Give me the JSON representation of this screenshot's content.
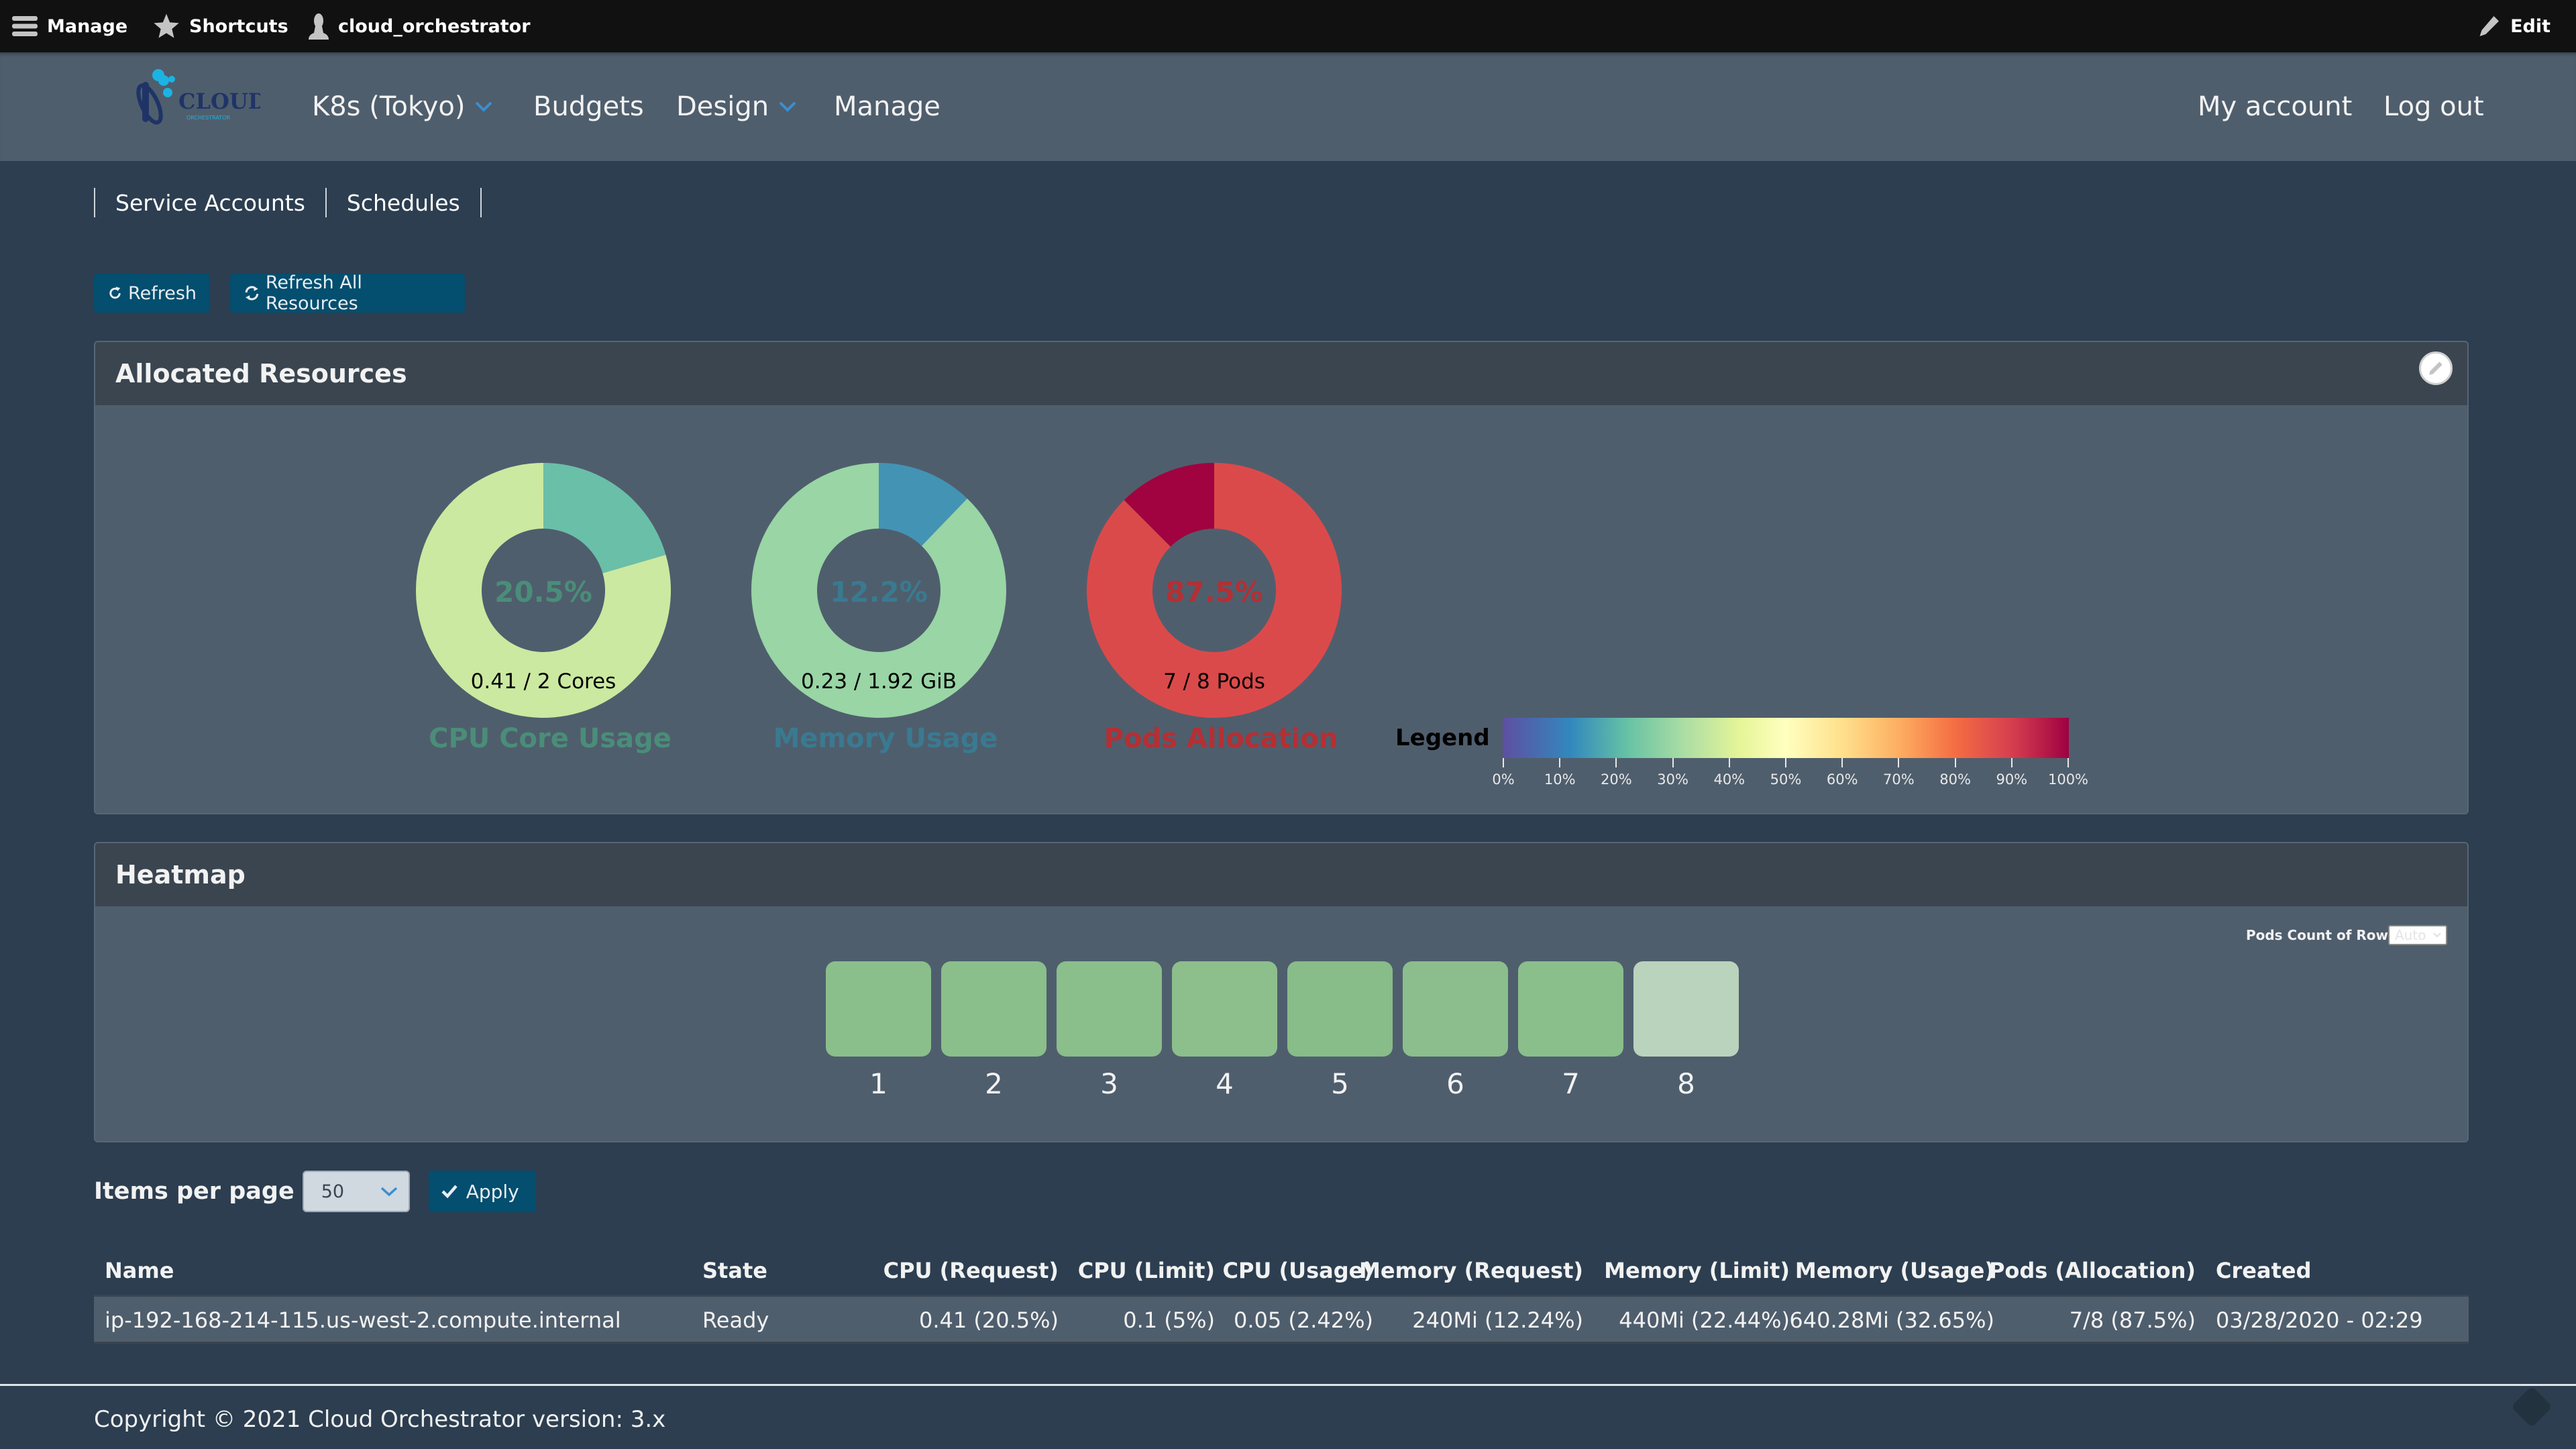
{
  "toolbar": {
    "manage_label": "Manage",
    "shortcuts_label": "Shortcuts",
    "user_label": "cloud_orchestrator",
    "edit_label": "Edit"
  },
  "navbar": {
    "logo_text": "CLOUD",
    "logo_subtext": "ORCHESTRATOR",
    "items": [
      {
        "label": "K8s (Tokyo)",
        "has_dropdown": true
      },
      {
        "label": "Budgets",
        "has_dropdown": false
      },
      {
        "label": "Design",
        "has_dropdown": true
      },
      {
        "label": "Manage",
        "has_dropdown": false
      }
    ],
    "account_label": "My account",
    "logout_label": "Log out"
  },
  "subnav": {
    "links": [
      "Service Accounts",
      "Schedules"
    ]
  },
  "actions": {
    "refresh_label": "Refresh",
    "refresh_all_label": "Refresh All Resources"
  },
  "allocated": {
    "title": "Allocated Resources",
    "donuts": [
      {
        "title": "CPU Core Usage",
        "percent_label": "20.5%",
        "percent": 20.5,
        "detail": "0.41 / 2 Cores",
        "used_color": "#6abfa9",
        "rest_color": "#cbe9a0",
        "text_color": "#4a8d79"
      },
      {
        "title": "Memory Usage",
        "percent_label": "12.2%",
        "percent": 12.2,
        "detail": "0.23 / 1.92 GiB",
        "used_color": "#4393b4",
        "rest_color": "#99d5a5",
        "text_color": "#3a7a90"
      },
      {
        "title": "Pods Allocation",
        "percent_label": "87.5%",
        "percent": 87.5,
        "detail": "7 / 8 Pods",
        "used_color": "#db4a4b",
        "rest_color": "#a0033f",
        "text_color": "#b52f33"
      }
    ],
    "legend": {
      "label": "Legend",
      "ticks": [
        "0%",
        "10%",
        "20%",
        "30%",
        "40%",
        "50%",
        "60%",
        "70%",
        "80%",
        "90%",
        "100%"
      ]
    }
  },
  "heatmap": {
    "title": "Heatmap",
    "pods_count_label": "Pods Count of Row",
    "pods_count_value": "Auto",
    "cells": [
      {
        "label": "1",
        "color": "#8abe8b"
      },
      {
        "label": "2",
        "color": "#8abe8b"
      },
      {
        "label": "3",
        "color": "#8abe8b"
      },
      {
        "label": "4",
        "color": "#8dbf8d"
      },
      {
        "label": "5",
        "color": "#88bc88"
      },
      {
        "label": "6",
        "color": "#8bbe8c"
      },
      {
        "label": "7",
        "color": "#8abe8b"
      },
      {
        "label": "8",
        "color": "#bad3bd"
      }
    ]
  },
  "pagination": {
    "items_per_page_label": "Items per page",
    "items_per_page_value": "50",
    "apply_label": "Apply"
  },
  "table": {
    "columns": [
      "Name",
      "State",
      "CPU (Request)",
      "CPU (Limit)",
      "CPU (Usage)",
      "Memory (Request)",
      "Memory (Limit)",
      "Memory (Usage)",
      "Pods (Allocation)",
      "Created"
    ],
    "rows": [
      [
        "ip-192-168-214-115.us-west-2.compute.internal",
        "Ready",
        "0.41 (20.5%)",
        "0.1 (5%)",
        "0.05 (2.42%)",
        "240Mi (12.24%)",
        "440Mi (22.44%)",
        "640.28Mi (32.65%)",
        "7/8 (87.5%)",
        "03/28/2020 - 02:29"
      ]
    ]
  },
  "footer": {
    "text": "Copyright © 2021 Cloud Orchestrator version: 3.x"
  }
}
